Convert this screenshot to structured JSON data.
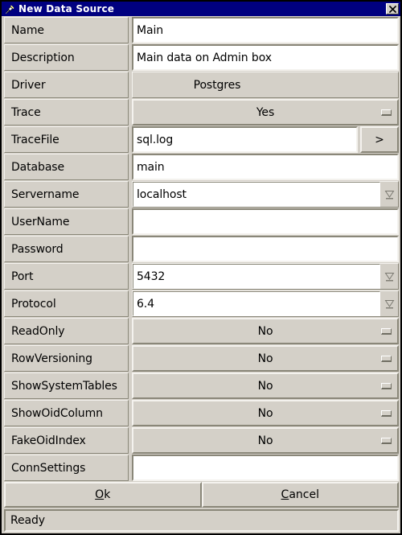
{
  "window": {
    "title": "New Data Source",
    "icon": "pushpin-icon",
    "close_label": "✕",
    "colors": {
      "titlebar_background": "#000080",
      "titlebar_text": "#ffffff",
      "window_background": "#d4d0c8",
      "field_background": "#ffffff",
      "shadow": "#8a8779",
      "highlight": "#f4f2ee",
      "border": "#000000"
    }
  },
  "form": {
    "rows": [
      {
        "label": "Name",
        "type": "text",
        "value": "Main"
      },
      {
        "label": "Description",
        "type": "text",
        "value": "Main data on Admin box"
      },
      {
        "label": "Driver",
        "type": "readonly",
        "value": "Postgres"
      },
      {
        "label": "Trace",
        "type": "option",
        "value": "Yes"
      },
      {
        "label": "TraceFile",
        "type": "text-browse",
        "value": "sql.log",
        "button_label": ">"
      },
      {
        "label": "Database",
        "type": "text",
        "value": "main"
      },
      {
        "label": "Servername",
        "type": "combo",
        "value": "localhost"
      },
      {
        "label": "UserName",
        "type": "text",
        "value": ""
      },
      {
        "label": "Password",
        "type": "text",
        "value": ""
      },
      {
        "label": "Port",
        "type": "combo",
        "value": "5432"
      },
      {
        "label": "Protocol",
        "type": "combo",
        "value": "6.4"
      },
      {
        "label": "ReadOnly",
        "type": "option",
        "value": "No"
      },
      {
        "label": "RowVersioning",
        "type": "option",
        "value": "No"
      },
      {
        "label": "ShowSystemTables",
        "type": "option",
        "value": "No"
      },
      {
        "label": "ShowOidColumn",
        "type": "option",
        "value": "No"
      },
      {
        "label": "FakeOidIndex",
        "type": "option",
        "value": "No"
      },
      {
        "label": "ConnSettings",
        "type": "text",
        "value": ""
      }
    ]
  },
  "actions": {
    "ok": {
      "label": "Ok",
      "mnemonic": "O"
    },
    "cancel": {
      "label": "Cancel",
      "mnemonic": "C"
    }
  },
  "statusbar": {
    "text": "Ready"
  }
}
